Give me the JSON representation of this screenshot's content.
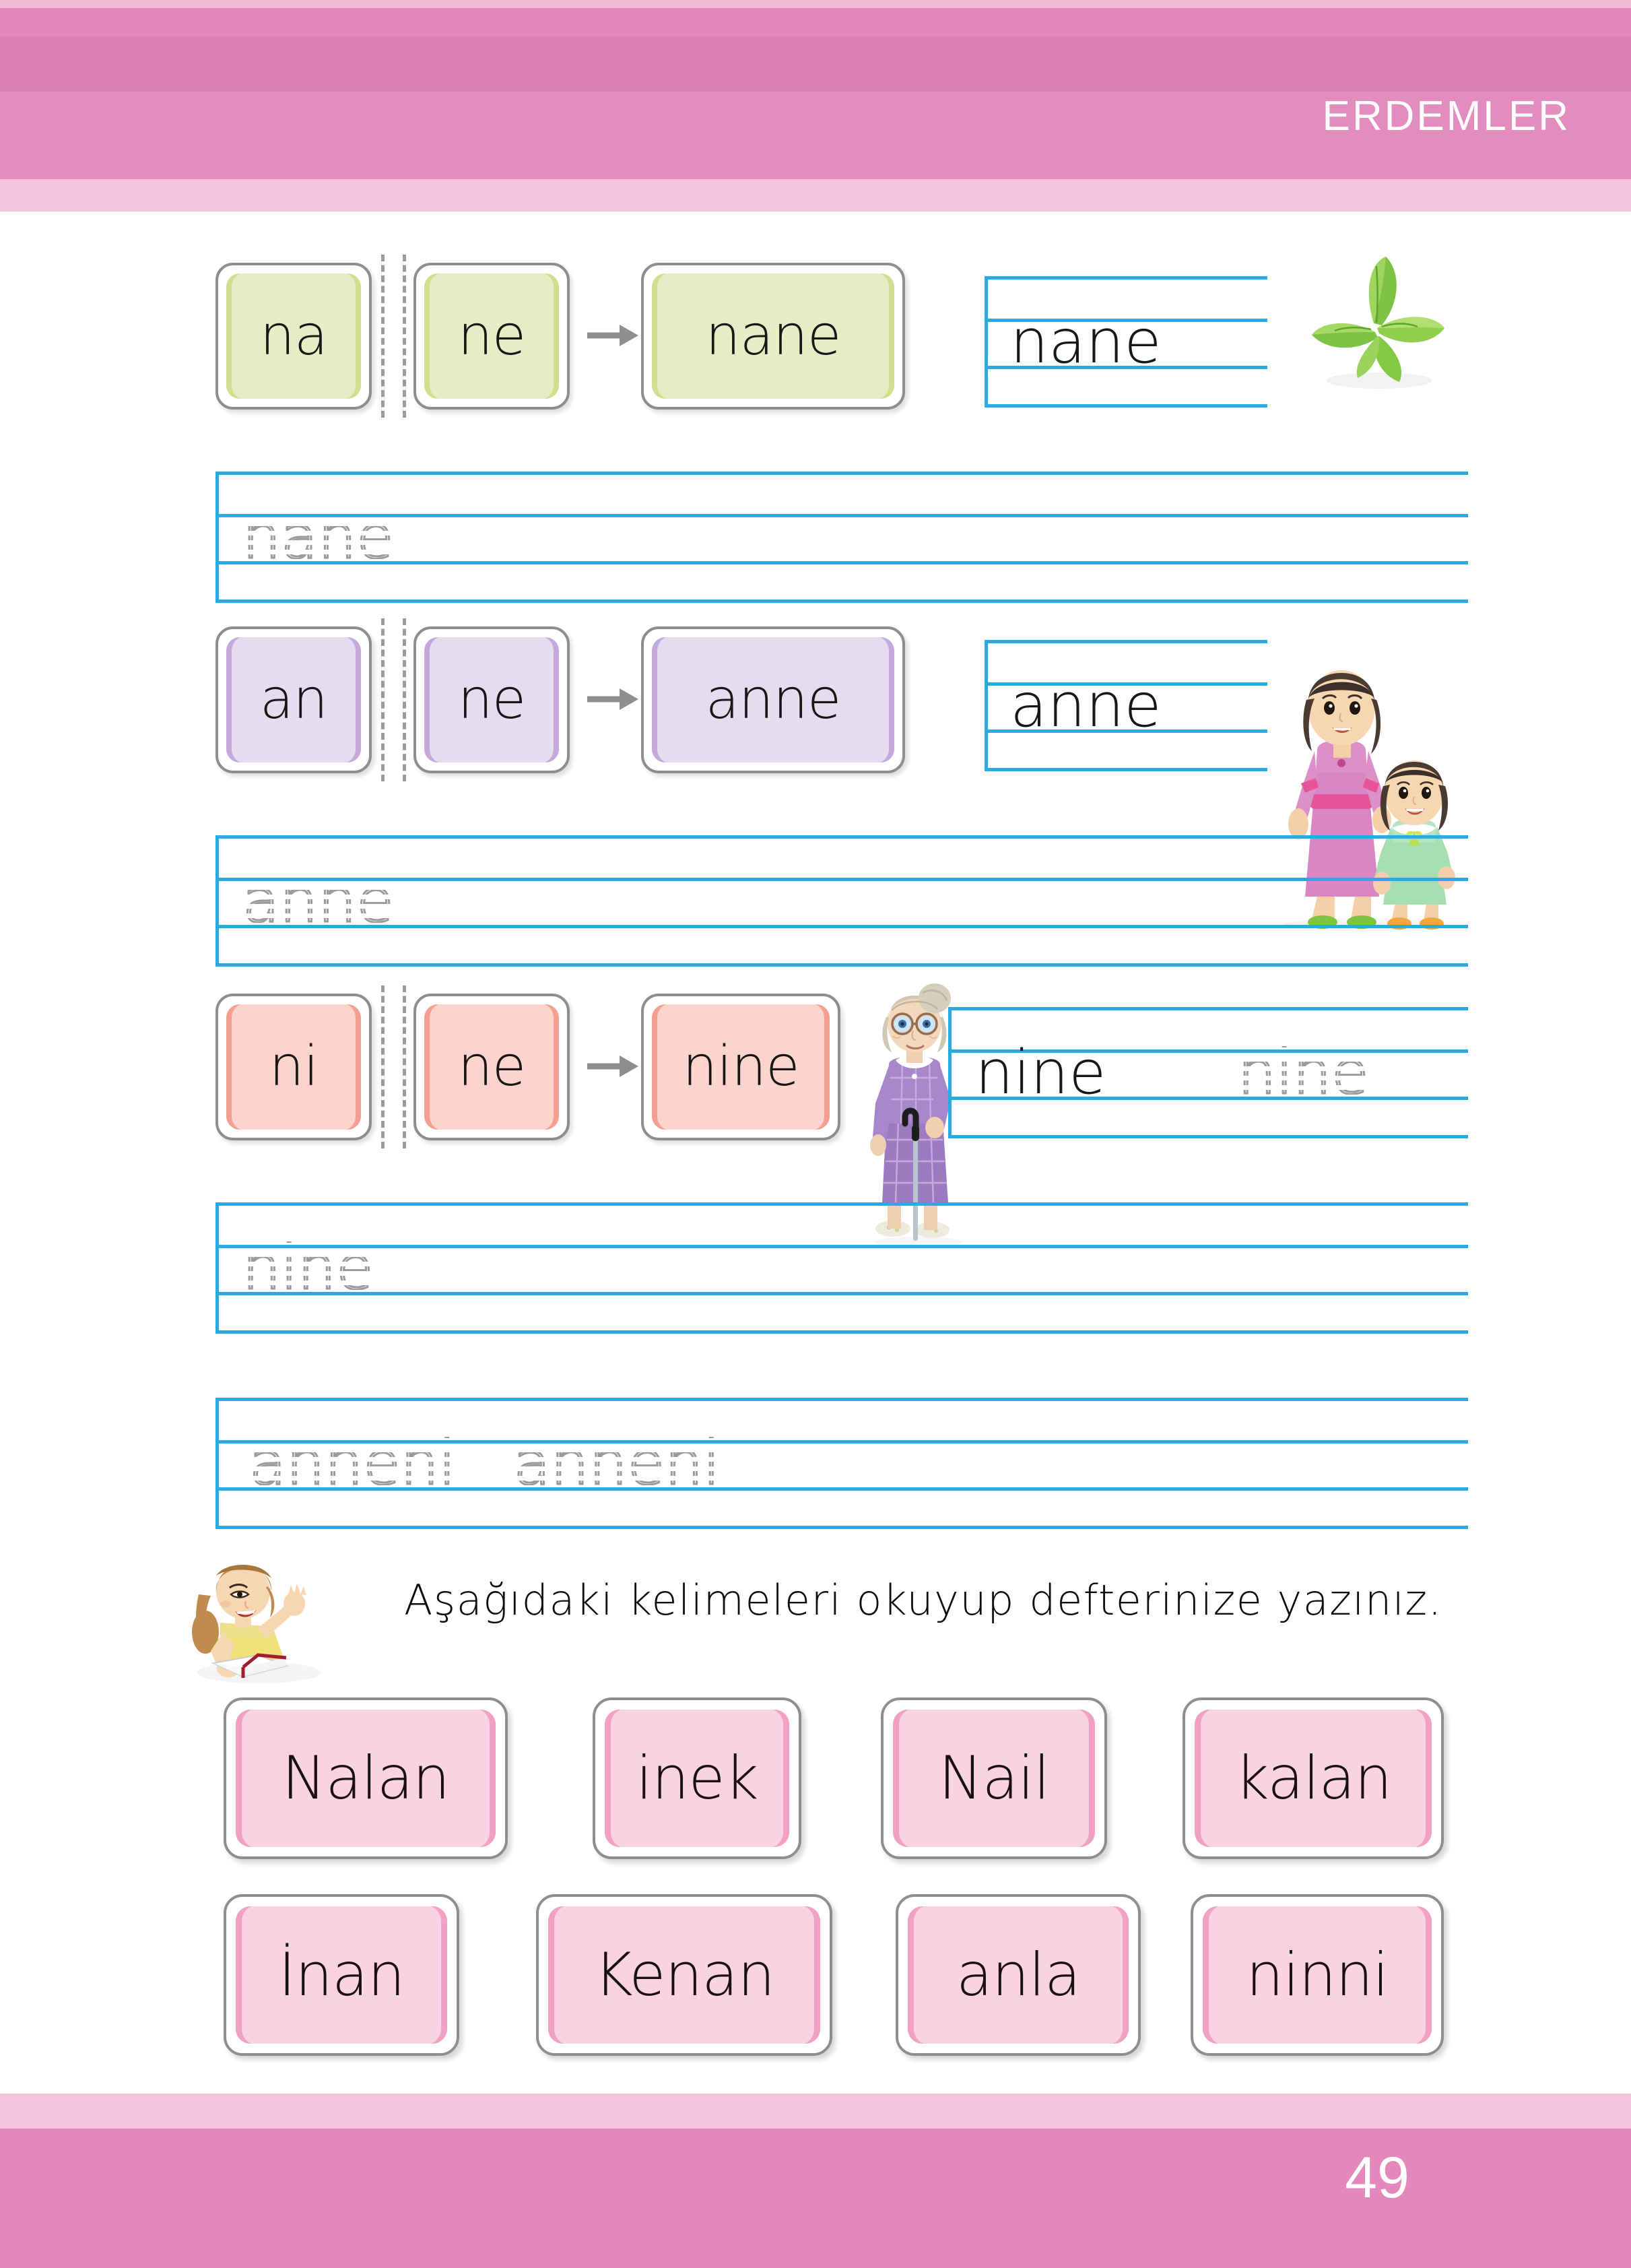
{
  "header": {
    "title": "ERDEMLER",
    "band_colors": [
      "#f4b9d7",
      "#e288bb",
      "#dd7eb4",
      "#e28dbe",
      "#f4c3de"
    ]
  },
  "footer": {
    "page_number": "49",
    "band_colors": [
      "#f4c3de",
      "#e288bb"
    ]
  },
  "colors": {
    "line_blue": "#29abe2",
    "dot_gray": "#9b9b9b",
    "card_border": "#8e8e8e",
    "green_fill": "#e6edc4",
    "green_edge": "#cfdf8e",
    "purple_fill": "#e6dcf0",
    "purple_edge": "#c5a9dd",
    "salmon_fill": "#fbd5cd",
    "salmon_edge": "#f3a092",
    "pink_fill": "#fad3e3",
    "pink_edge": "#f2a1c4"
  },
  "exercises": [
    {
      "id": "nane",
      "theme": "green",
      "syllable_1": "na",
      "syllable_2": "ne",
      "result": "nane",
      "arrow": "arrow-right-icon",
      "written_word": "nane",
      "picture": "mint-leaves-image",
      "trace_line": "nane"
    },
    {
      "id": "anne",
      "theme": "purple",
      "syllable_1": "an",
      "syllable_2": "ne",
      "result": "anne",
      "arrow": "arrow-right-icon",
      "written_word": "anne",
      "picture": "mother-and-daughter-image",
      "trace_line": "anne"
    },
    {
      "id": "nine",
      "theme": "salmon",
      "syllable_1": "ni",
      "syllable_2": "ne",
      "result": "nine",
      "arrow": "arrow-right-icon",
      "written_word": "nine",
      "written_word_traced": "nine",
      "picture": "grandmother-image",
      "trace_line": "nine"
    }
  ],
  "sentence_trace": {
    "text": "anneni   anneni"
  },
  "instruction": {
    "icon": "girl-reading-book-image",
    "text": "Aşağıdaki kelimeleri okuyup defterinize yazınız."
  },
  "word_cards": [
    {
      "label": "Nalan"
    },
    {
      "label": "inek"
    },
    {
      "label": "Nail"
    },
    {
      "label": "kalan"
    },
    {
      "label": "İnan"
    },
    {
      "label": "Kenan"
    },
    {
      "label": "anla"
    },
    {
      "label": "ninni"
    }
  ]
}
